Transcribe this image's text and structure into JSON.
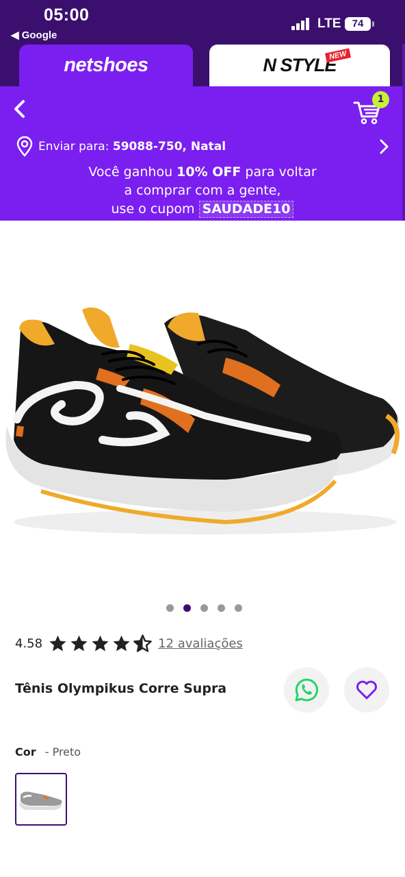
{
  "status_bar": {
    "time": "05:00",
    "back_app": "◀ Google",
    "network": "LTE",
    "battery": "74"
  },
  "brand_tabs": {
    "primary": "netshoes",
    "secondary": "N STYLE",
    "badge": "NEW"
  },
  "header": {
    "cart_count": "1"
  },
  "shipping": {
    "label": "Enviar para:",
    "value": "59088-750, Natal"
  },
  "promo": {
    "line1_pre": "Você ganhou ",
    "line1_bold": "10% OFF",
    "line1_post": " para voltar",
    "line2": "a comprar com a gente,",
    "line3_pre": "use o cupom ",
    "coupon": "SAUDADE10"
  },
  "gallery": {
    "current_index": 2,
    "total": 5
  },
  "rating": {
    "value": "4.58",
    "reviews": "12 avaliações",
    "stars_out_of_5": 4.58
  },
  "product": {
    "title": "Tênis Olympikus Corre Supra"
  },
  "color": {
    "label": "Cor",
    "value": "- Preto"
  },
  "colors": {
    "brand_purple": "#7a1ff0",
    "dark_purple": "#3b0f6e",
    "badge_green": "#c6f135",
    "whatsapp": "#25d366"
  }
}
